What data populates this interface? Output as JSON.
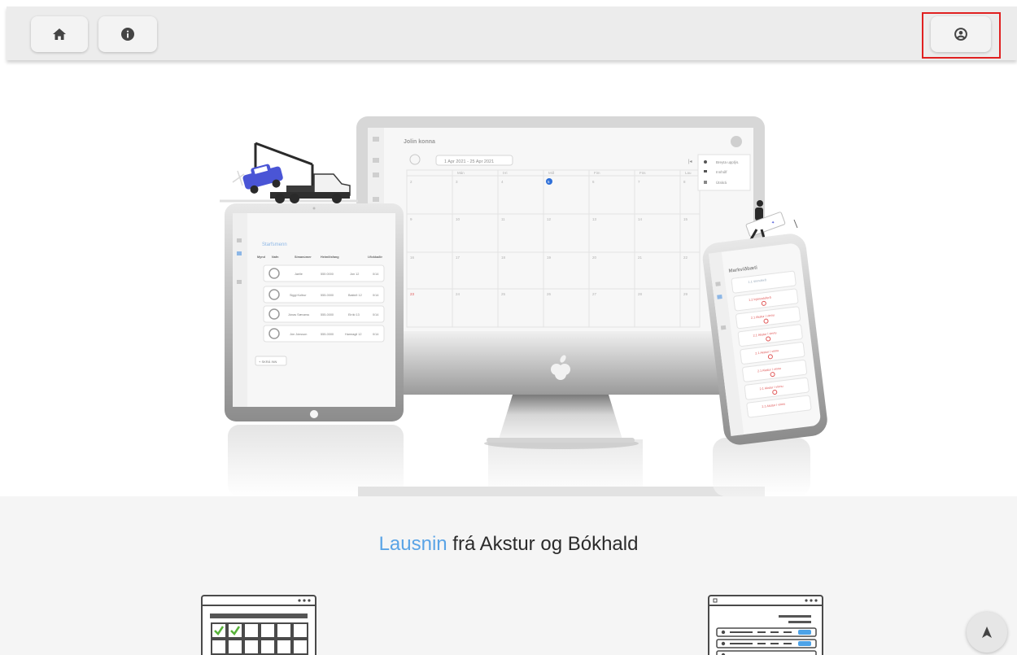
{
  "nav": {
    "home_icon": "home-icon",
    "info_icon": "info-icon",
    "account_icon": "account-circle-icon"
  },
  "section": {
    "title_accent": "Lausnin",
    "title_rest": " frá Akstur og Bókhald"
  },
  "mockup": {
    "monitor": {
      "user_name": "Jolin konna",
      "date_range": "1 Apr 2021 - 25 Apr 2021",
      "weekdays": [
        "Mán",
        "Þri",
        "Mið",
        "Fim",
        "Fös",
        "Lau"
      ],
      "week1": [
        "2",
        "3",
        "4",
        "5",
        "6",
        "7",
        "8"
      ],
      "week2": [
        "9",
        "10",
        "11",
        "12",
        "13",
        "14",
        "15"
      ],
      "week3": [
        "16",
        "17",
        "18",
        "19",
        "20",
        "21",
        "22"
      ],
      "week4": [
        "23",
        "24",
        "25",
        "26",
        "27",
        "28",
        "29"
      ],
      "menu": [
        "Breyta upplýs.",
        "Innhólf",
        "Útskrá"
      ]
    },
    "tablet": {
      "title": "Starfsmenn",
      "headers": [
        "Mynd",
        "Nafn",
        "Símanúmer",
        "Heimilisfang",
        "I.flokkaðir"
      ],
      "rows": [
        [
          "Jaelle",
          "555 0000",
          "Jón 12",
          "0/14"
        ],
        [
          "Siggi Kolbur",
          "555-0000",
          "Bakkið 12",
          "0/14"
        ],
        [
          "Jónas Sævarss",
          "555-0000",
          "Eiríki 13",
          "0/14"
        ],
        [
          "Jón Jónsson",
          "555-0000",
          "Hamragil 12",
          "0/14"
        ]
      ],
      "add_button": "+ SKRÁ INN"
    },
    "phone": {
      "title": "Markviðbæti",
      "items": [
        "1.1 Vinnuferð",
        "1.2 Þjónustuferð",
        "2.1 Akstur í vinnu",
        "2.1 Akstur í vinnu",
        "2.1 Akstur í vinnu",
        "2.1 Akstur í vinnu",
        "2.1 Akstur í vinnu",
        "2.1 Akstur í vinnu"
      ]
    }
  },
  "colors": {
    "accent": "#5aa4e6",
    "highlight": "#e02020",
    "topbar": "#ececec"
  },
  "totop_icon": "arrow-up-icon"
}
